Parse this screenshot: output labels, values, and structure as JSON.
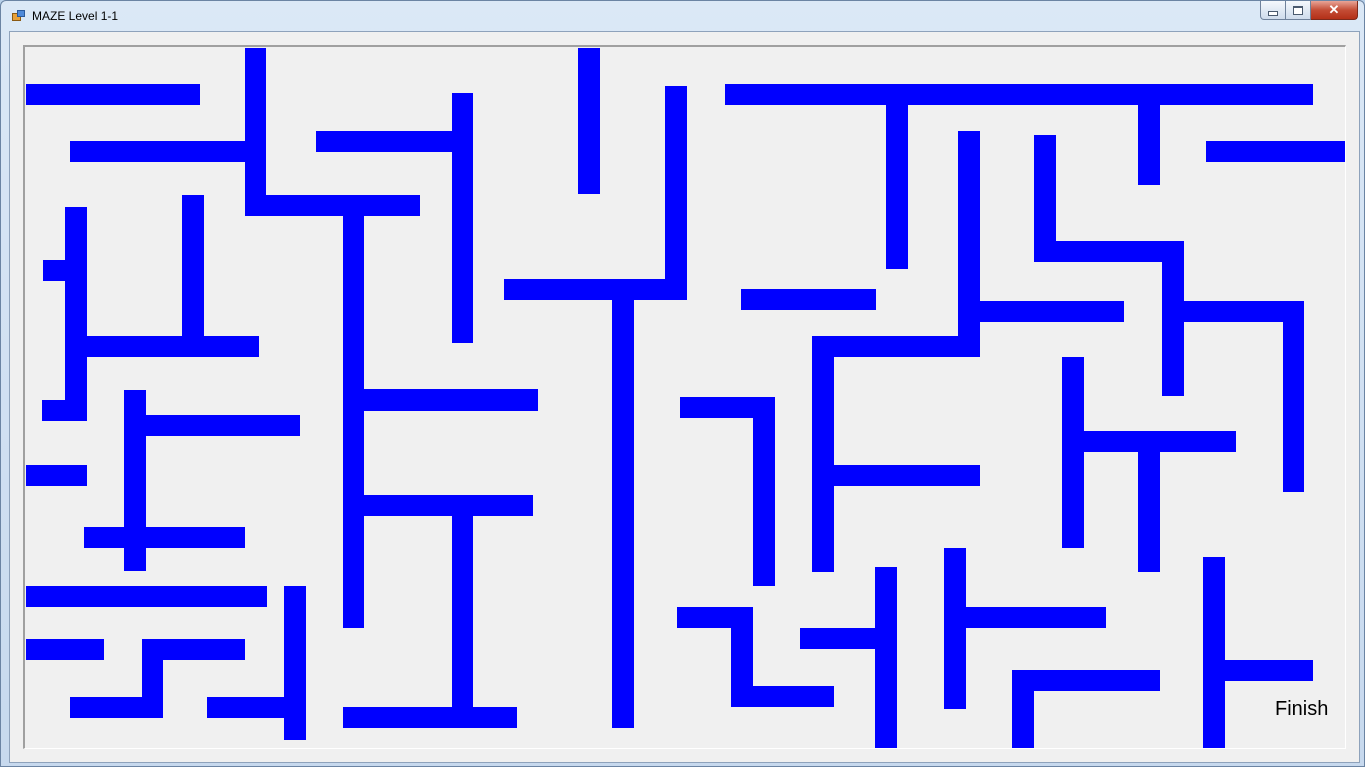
{
  "window": {
    "title": "MAZE Level 1-1",
    "buttons": {
      "minimize": "",
      "maximize": "",
      "close": "✕"
    }
  },
  "maze": {
    "wall_color": "#0000ff",
    "background_color": "#f0f0f0",
    "finish_label": "Finish"
  }
}
